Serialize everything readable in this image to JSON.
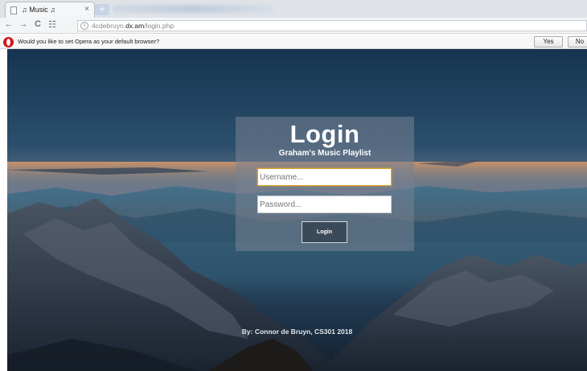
{
  "browser": {
    "tab": {
      "title": "♫ Music ♫",
      "close": "×"
    },
    "new_tab": "+",
    "nav": {
      "back": "←",
      "forward": "→",
      "reload": "C",
      "speed_dial": "☷"
    },
    "url": {
      "prefix": "4cdebruyn.",
      "domain": "dx.am",
      "path": "/login.php"
    },
    "infobar": {
      "message": "Would you like to set Opera as your default browser?",
      "yes_label": "Yes",
      "no_label": "No"
    }
  },
  "login": {
    "title": "Login",
    "subtitle": "Graham's Music Playlist",
    "username_placeholder": "Username...",
    "password_placeholder": "Password...",
    "button_label": "Login"
  },
  "footer": {
    "credit": "By: Connor de Bruyn, CS301 2018"
  },
  "colors": {
    "panel": "rgba(120,130,145,0.55)",
    "focus_border": "#e0a526",
    "button": "#3b4a58",
    "opera_red": "#d51414"
  }
}
